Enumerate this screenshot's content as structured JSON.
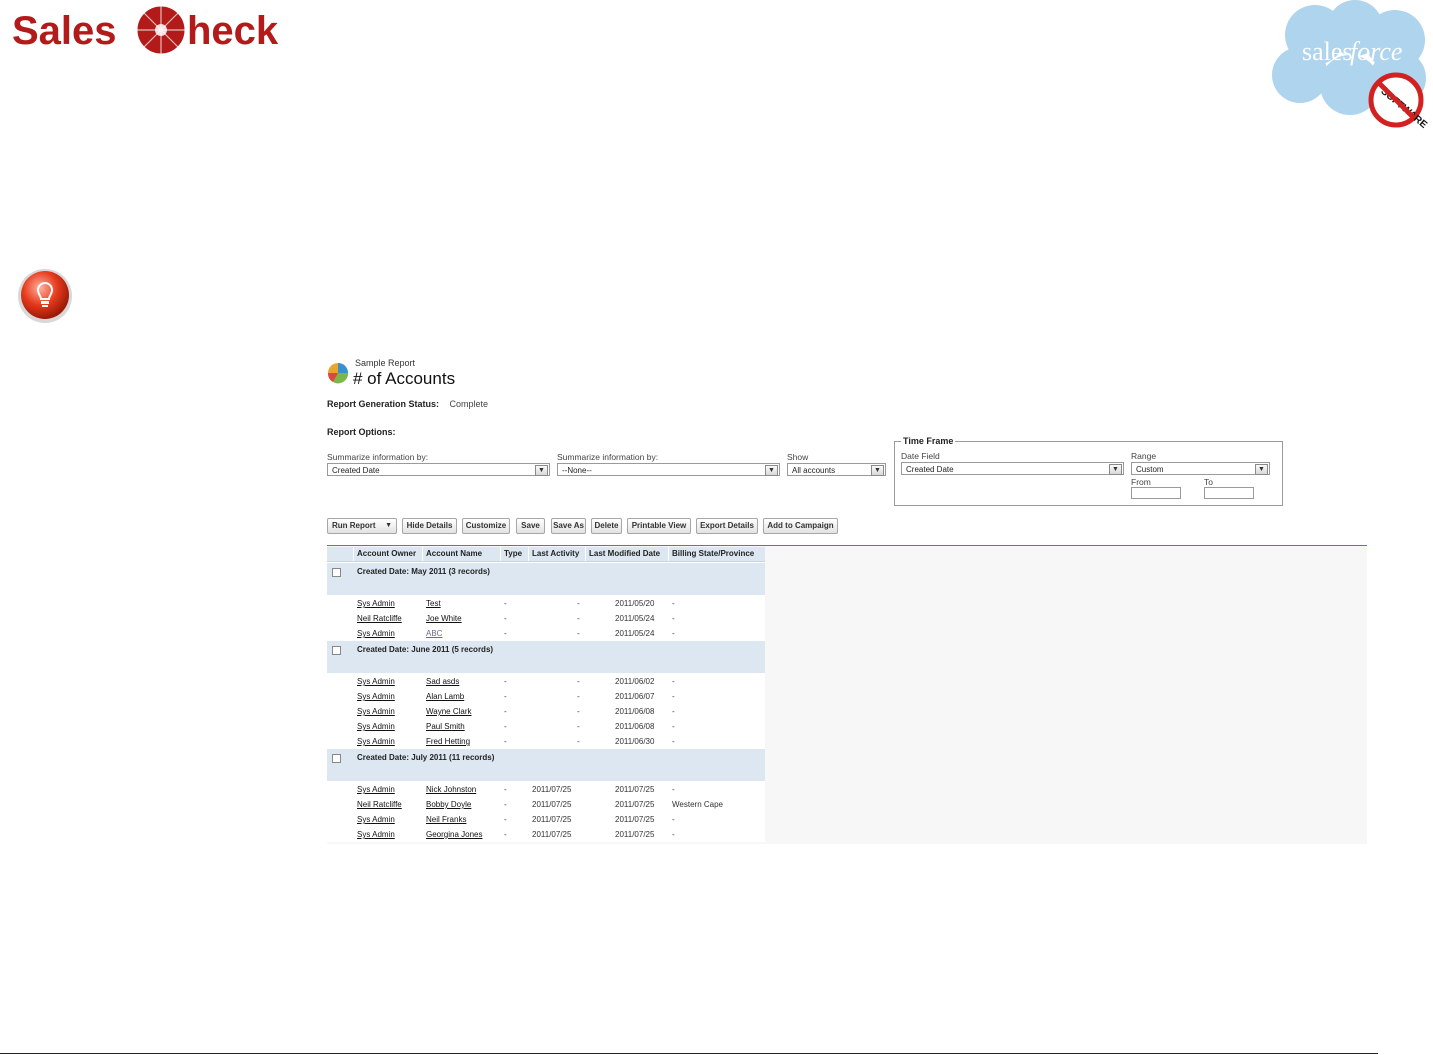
{
  "brand": {
    "salescheck_left": "Sales",
    "salescheck_right": "heck",
    "salesforce_word_a": "sales",
    "salesforce_word_b": "force",
    "software_stamp": "SOFTWARE",
    "colors": {
      "salescheck_red": "#b31b1b",
      "cloud_blue": "#aed4ee",
      "no_red": "#d32020"
    }
  },
  "report": {
    "subtitle": "Sample Report",
    "title": "# of Accounts",
    "status_label": "Report Generation Status:",
    "status_value": "Complete",
    "options_label": "Report Options:",
    "summarize1": {
      "label": "Summarize information by:",
      "value": "Created Date"
    },
    "summarize2": {
      "label": "Summarize information by:",
      "value": "--None--"
    },
    "show": {
      "label": "Show",
      "value": "All accounts"
    },
    "timeframe": {
      "legend": "Time Frame",
      "date_field_label": "Date Field",
      "date_field_value": "Created Date",
      "range_label": "Range",
      "range_value": "Custom",
      "from_label": "From",
      "to_label": "To"
    },
    "toolbar": {
      "run_report": "Run Report",
      "hide_details": "Hide Details",
      "customize": "Customize",
      "save": "Save",
      "save_as": "Save As",
      "delete": "Delete",
      "printable_view": "Printable View",
      "export_details": "Export Details",
      "add_to_campaign": "Add to Campaign"
    },
    "columns": [
      "Account Owner",
      "Account Name",
      "Type",
      "Last Activity",
      "Last Modified Date",
      "Billing State/Province"
    ],
    "groups": [
      {
        "label": "Created Date: May 2011 (3 records)",
        "rows": [
          [
            "Sys Admin",
            "Test",
            "-",
            "-",
            "2011/05/20",
            "-"
          ],
          [
            "Neil Ratcliffe",
            "Joe White",
            "-",
            "-",
            "2011/05/24",
            "-"
          ],
          [
            "Sys Admin",
            "ABC",
            "-",
            "-",
            "2011/05/24",
            "-"
          ]
        ]
      },
      {
        "label": "Created Date: June 2011 (5 records)",
        "rows": [
          [
            "Sys Admin",
            "Sad asds",
            "-",
            "-",
            "2011/06/02",
            "-"
          ],
          [
            "Sys Admin",
            "Alan Lamb",
            "-",
            "-",
            "2011/06/07",
            "-"
          ],
          [
            "Sys Admin",
            "Wayne Clark",
            "-",
            "-",
            "2011/06/08",
            "-"
          ],
          [
            "Sys Admin",
            "Paul Smith",
            "-",
            "-",
            "2011/06/08",
            "-"
          ],
          [
            "Sys Admin",
            "Fred Hetting",
            "-",
            "-",
            "2011/06/30",
            "-"
          ]
        ]
      },
      {
        "label": "Created Date: July 2011 (11 records)",
        "rows": [
          [
            "Sys Admin",
            "Nick Johnston",
            "-",
            "2011/07/25",
            "2011/07/25",
            "-"
          ],
          [
            "Neil Ratcliffe",
            "Bobby Doyle",
            "-",
            "2011/07/25",
            "2011/07/25",
            "Western Cape"
          ],
          [
            "Sys Admin",
            "Neil Franks",
            "-",
            "2011/07/25",
            "2011/07/25",
            "-"
          ],
          [
            "Sys Admin",
            "Georgina Jones",
            "-",
            "2011/07/25",
            "2011/07/25",
            "-"
          ]
        ]
      }
    ]
  }
}
